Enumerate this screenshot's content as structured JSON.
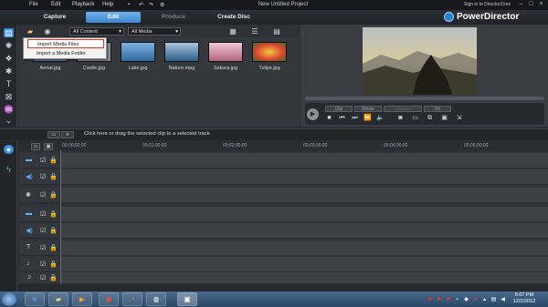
{
  "menubar": {
    "items": [
      "File",
      "Edit",
      "Playback",
      "Help"
    ],
    "window_title": "New Untitled Project",
    "help_zone": "Sign in to DirectorZone"
  },
  "tabs": [
    {
      "label": "Capture"
    },
    {
      "label": "Edit"
    },
    {
      "label": "Produce"
    },
    {
      "label": "Create Disc"
    }
  ],
  "brand": "PowerDirector",
  "library": {
    "content_filter": "All Content",
    "media_filter": "All Media",
    "popup": [
      "Import Media Files",
      "Import a Media Folder"
    ],
    "thumbnails": [
      {
        "name": "Aerial.jpg",
        "color": "#5b7ca6"
      },
      {
        "name": "Castle.jpg",
        "color": "#8a8f9a"
      },
      {
        "name": "Lake.jpg",
        "color": "#4e86b9"
      },
      {
        "name": "Nature.mpg",
        "color": "#3b6f9c"
      },
      {
        "name": "Sakura.jpg",
        "color": "#c98aa0"
      },
      {
        "name": "Tulips.jpg",
        "color": "#d9442d"
      }
    ]
  },
  "preview": {
    "clip_label": "Clip",
    "movie_label": "Movie",
    "timecode": "--;--;--;--",
    "fit_label": "Fit"
  },
  "instruction": "Click here or drag the selected clip to a selected track.",
  "timeline": {
    "ticks": [
      "00;00;00;00",
      "00;01;00;00",
      "00;02;00;00",
      "00;03;00;00",
      "00;04;00;00",
      "00;05;00;00"
    ]
  },
  "taskbar": {
    "time": "5:07 PM",
    "date": "12/2/2012"
  }
}
